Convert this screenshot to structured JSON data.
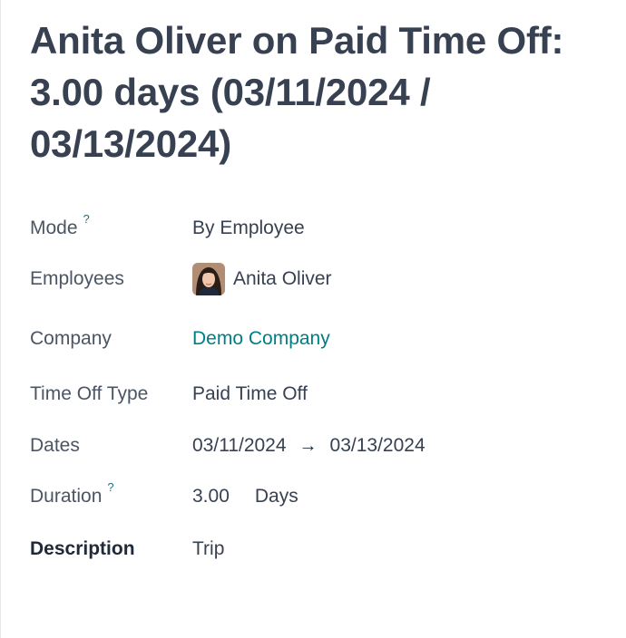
{
  "record": {
    "title": "Anita Oliver on Paid Time Off: 3.00 days (03/11/2024 / 03/13/2024)"
  },
  "help_mark": "?",
  "fields": {
    "mode": {
      "label": "Mode",
      "value": "By Employee"
    },
    "employees": {
      "label": "Employees",
      "value": "Anita Oliver"
    },
    "company": {
      "label": "Company",
      "value": "Demo Company"
    },
    "time_off_type": {
      "label": "Time Off Type",
      "value": "Paid Time Off"
    },
    "dates": {
      "label": "Dates",
      "from": "03/11/2024",
      "arrow": "→",
      "to": "03/13/2024"
    },
    "duration": {
      "label": "Duration",
      "number": "3.00",
      "unit": "Days"
    },
    "description": {
      "label": "Description",
      "value": "Trip"
    }
  },
  "colors": {
    "link": "#017e84",
    "help": "#0e7490",
    "text": "#374151"
  }
}
